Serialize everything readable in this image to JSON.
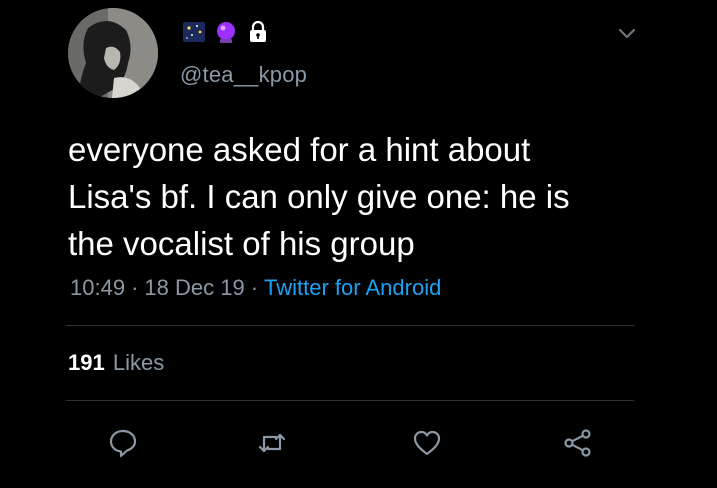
{
  "tweet": {
    "author_handle": "@tea__kpop",
    "text": "everyone asked for a hint about\nLisa's bf. I can only give one: he is\nthe vocalist of his group",
    "time": "10:49",
    "date": "18 Dec 19",
    "source": "Twitter for Android",
    "separator": "·",
    "likes_count": "191",
    "likes_label": "Likes"
  },
  "icons": {
    "display_name_emojis": [
      "night-sky-emoji",
      "crystal-ball-emoji",
      "lock-icon"
    ],
    "actions": [
      "reply-icon",
      "retweet-icon",
      "like-icon",
      "share-icon"
    ]
  },
  "colors": {
    "background": "#000000",
    "secondary_text": "#8b98a5",
    "link": "#1da1f2"
  }
}
